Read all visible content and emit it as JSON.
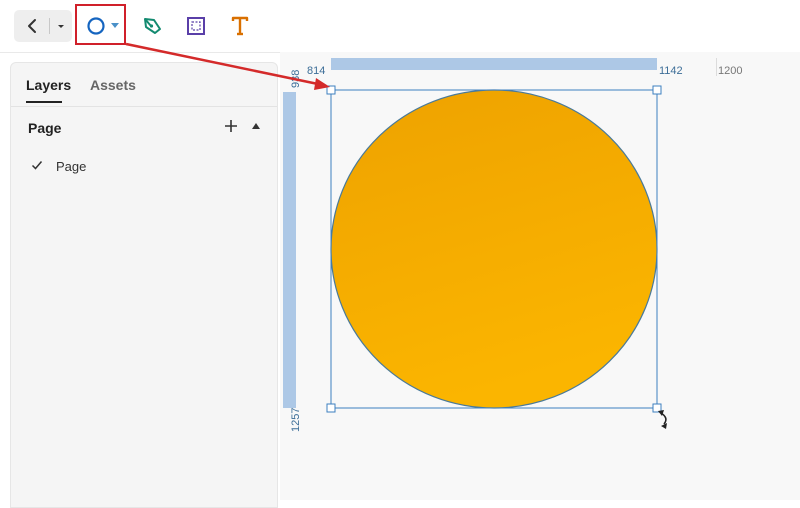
{
  "toolbar": {
    "back_label": "Back",
    "tools": [
      "ellipse",
      "path",
      "board",
      "text"
    ]
  },
  "sidebar": {
    "tabs": [
      {
        "label": "Layers",
        "active": true
      },
      {
        "label": "Assets",
        "active": false
      }
    ],
    "section_title": "Page",
    "pages": [
      {
        "name": "Page",
        "selected": true
      }
    ]
  },
  "canvas": {
    "ruler_top": {
      "selection_start": "814",
      "selection_end": "1142",
      "tick": "1200"
    },
    "ruler_left": {
      "selection_start": "938",
      "selection_end": "1257"
    },
    "shape": {
      "type": "ellipse",
      "fill": "#f2a900",
      "stroke": "#4a7a99",
      "selected": true
    }
  },
  "colors": {
    "accent": "#1565c0",
    "selection": "#3d7fbf",
    "highlight": "#d0202a",
    "ruler_highlight": "#adc8e6"
  }
}
